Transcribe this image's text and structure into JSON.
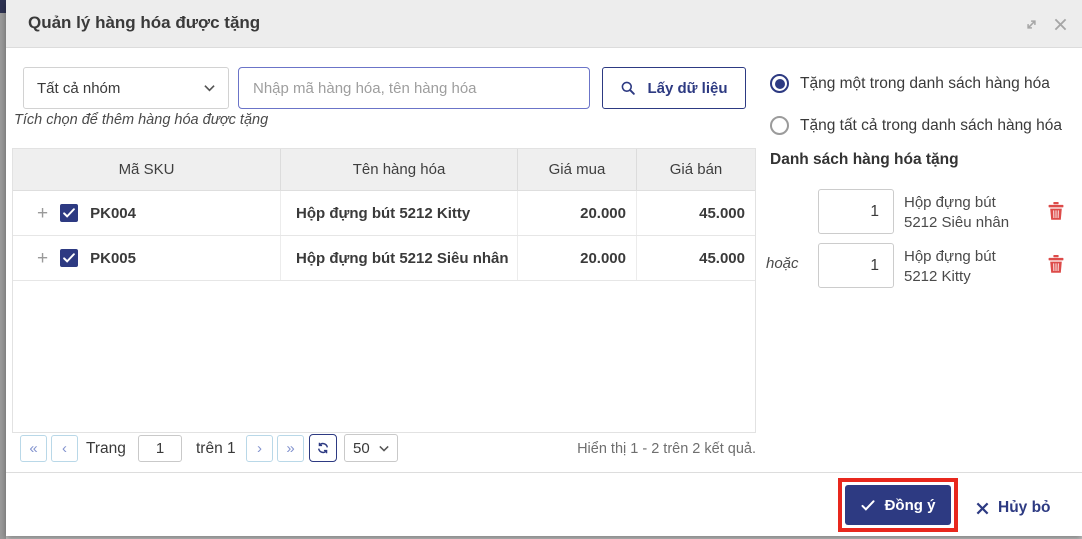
{
  "colors": {
    "primary_navy": "#2d3a82",
    "annotation_red": "#e8271d",
    "trash_red": "#dd4b49",
    "focused_input_border": "#6b74c8",
    "header_bg": "#ededed"
  },
  "dialog": {
    "title": "Quản lý hàng hóa được tặng"
  },
  "toolbar": {
    "group_select_value": "Tất cả nhóm",
    "search_placeholder": "Nhập mã hàng hóa, tên hàng hóa",
    "search_value": "",
    "fetch_button_label": "Lấy dữ liệu"
  },
  "gift_mode": {
    "option_one_label": "Tặng một trong danh sách hàng hóa",
    "option_all_label": "Tặng tất cả trong danh sách hàng hóa",
    "selected": "option_one"
  },
  "hint_text": "Tích chọn để thêm hàng hóa được tặng",
  "product_table": {
    "columns": [
      "Mã SKU",
      "Tên hàng hóa",
      "Giá mua",
      "Giá bán"
    ],
    "expand_glyph": "+",
    "rows": [
      {
        "sku": "PK004",
        "name": "Hộp đựng bút 5212 Kitty",
        "buy_price": "20.000",
        "sell_price": "45.000",
        "checked": true
      },
      {
        "sku": "PK005",
        "name": "Hộp đựng bút 5212 Siêu nhân",
        "buy_price": "20.000",
        "sell_price": "45.000",
        "checked": true
      }
    ]
  },
  "pagination": {
    "first_glyph": "«",
    "prev_glyph": "‹",
    "next_glyph": "›",
    "last_glyph": "»",
    "page_label": "Trang",
    "current_page": "1",
    "total_label": "trên 1",
    "page_size": "50",
    "results_summary": "Hiển thị 1 - 2 trên 2 kết quả."
  },
  "gift_list": {
    "heading": "Danh sách hàng hóa tặng",
    "or_label": "hoặc",
    "items": [
      {
        "qty": "1",
        "name_line1": "Hộp đựng bút",
        "name_line2": "5212 Siêu nhân"
      },
      {
        "qty": "1",
        "name_line1": "Hộp đựng bút",
        "name_line2": "5212 Kitty"
      }
    ]
  },
  "footer": {
    "confirm_label": "Đồng ý",
    "cancel_label": "Hủy bỏ"
  }
}
